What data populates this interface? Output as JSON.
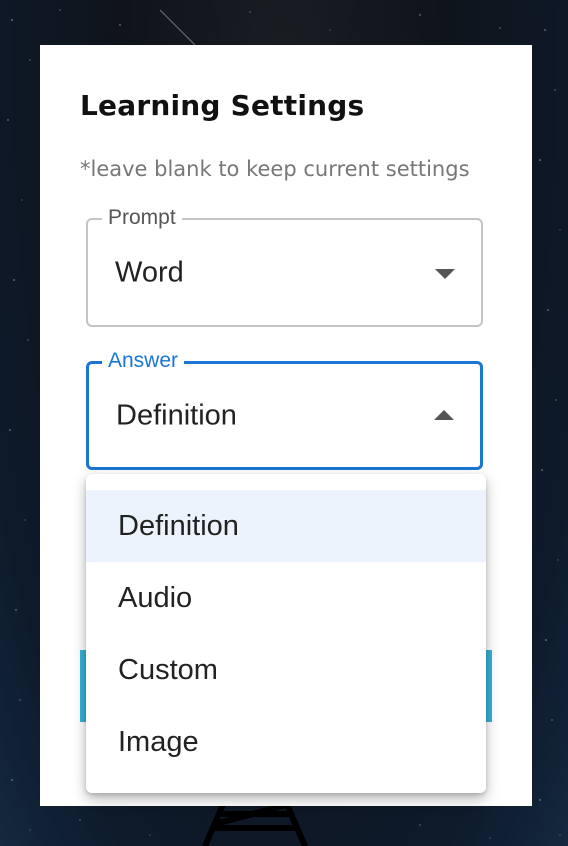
{
  "dialog": {
    "title": "Learning Settings",
    "hint": "*leave blank to keep current settings"
  },
  "fields": {
    "prompt": {
      "label": "Prompt",
      "value": "Word"
    },
    "answer": {
      "label": "Answer",
      "value": "Definition"
    }
  },
  "dropdown": {
    "options": [
      "Definition",
      "Audio",
      "Custom",
      "Image"
    ],
    "selected": "Definition"
  },
  "colors": {
    "accent": "#1976d2",
    "button": "#36b2d9",
    "selected_bg": "#edf3fc"
  }
}
